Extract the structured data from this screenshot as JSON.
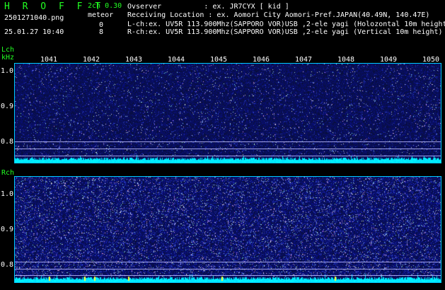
{
  "header": {
    "app_title": "H R O F F T",
    "filename": "2501271040.png",
    "timestamp": "25.01.27 10:40",
    "channels_version": "2ch 0.30",
    "meteor_label": "meteor",
    "lch_meteor_count": "0",
    "rch_meteor_count": "8"
  },
  "info": {
    "observer": "Ovserver          : ex. JR7CYX [ kid ]",
    "location": "Receiving Location : ex. Aomori City Aomori-Pref.JAPAN(40.49N, 140.47E)",
    "lch": "L-ch:ex. UV5R 113.900Mhz(SAPPORO VOR)USB ,2-ele yagi (Holozontal 10m height",
    "rch": "R-ch:ex. UV5R 113.900Mhz(SAPPORO VOR)USB ,2-ele yagi (Vertical 10m height)"
  },
  "lch": {
    "label": "Lch",
    "unit": "kHz",
    "y_ticks": [
      "1.0",
      "0.9",
      "0.8"
    ]
  },
  "rch": {
    "label": "Rch",
    "y_ticks": [
      "1.0",
      "0.9",
      "0.8"
    ]
  },
  "freq_ticks": [
    "1041",
    "1042",
    "1043",
    "1044",
    "1045",
    "1046",
    "1047",
    "1048",
    "1049",
    "1050"
  ],
  "colors": {
    "accent_green": "#22ff22",
    "noise_blue": "#1a2aa0",
    "spectrum_cyan": "#00e8ff"
  }
}
